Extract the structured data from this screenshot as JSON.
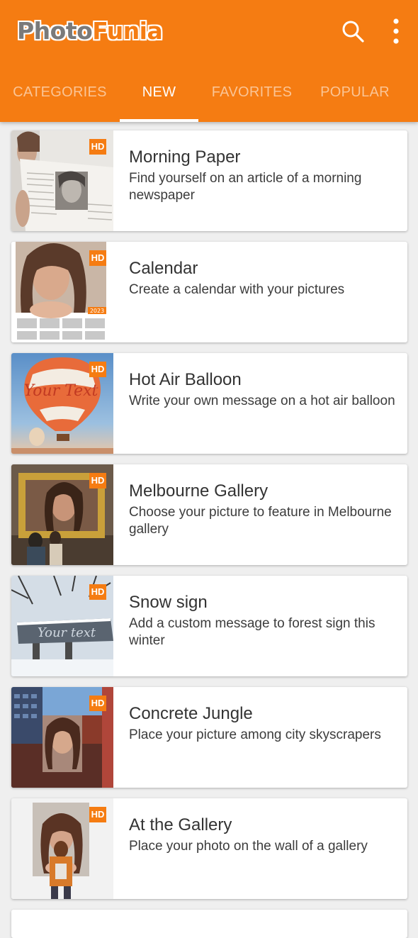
{
  "app": {
    "logo_part1": "Photo",
    "logo_part2": "Funia",
    "brand_color": "#f57c12"
  },
  "toolbar": {
    "search_icon": "search-icon",
    "more_icon": "more-vertical-icon"
  },
  "tabs": [
    {
      "label": "CATEGORIES",
      "active": false
    },
    {
      "label": "NEW",
      "active": true
    },
    {
      "label": "FAVORITES",
      "active": false
    },
    {
      "label": "POPULAR",
      "active": false
    }
  ],
  "effects": [
    {
      "title": "Morning Paper",
      "description": "Find yourself on an article of a morning newspaper",
      "badge": "HD"
    },
    {
      "title": "Calendar",
      "description": "Create a calendar with your pictures",
      "badge": "HD",
      "thumb_text": "2023"
    },
    {
      "title": "Hot Air Balloon",
      "description": "Write your own message on a hot air balloon",
      "badge": "HD",
      "thumb_text": "Your Text"
    },
    {
      "title": "Melbourne Gallery",
      "description": "Choose your picture to feature in Melbourne gallery",
      "badge": "HD"
    },
    {
      "title": "Snow sign",
      "description": "Add a custom message to forest sign this winter",
      "badge": "HD",
      "thumb_text": "Your text"
    },
    {
      "title": "Concrete Jungle",
      "description": "Place your picture among city skyscrapers",
      "badge": "HD"
    },
    {
      "title": "At the Gallery",
      "description": "Place your photo on the wall of a gallery",
      "badge": "HD"
    }
  ]
}
